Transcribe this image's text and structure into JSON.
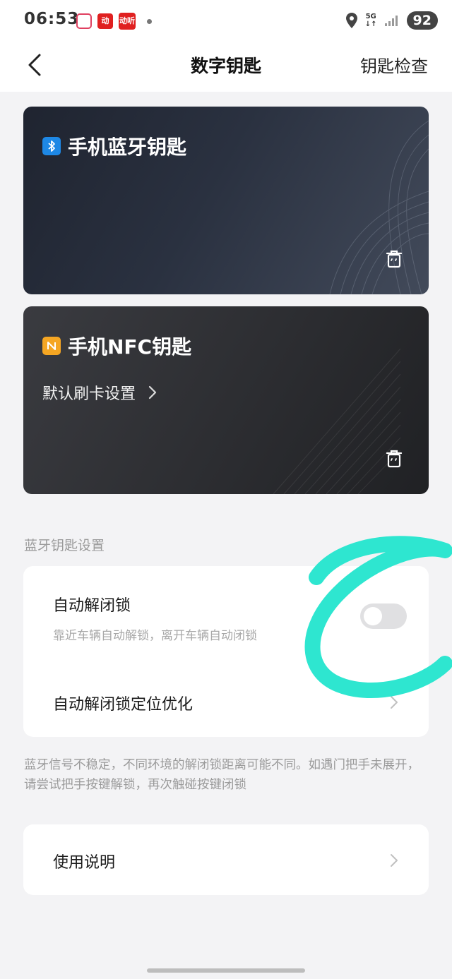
{
  "status_bar": {
    "time": "06:53",
    "app2": "动",
    "app3": "动听",
    "network": "5G",
    "battery": "92"
  },
  "nav": {
    "title": "数字钥匙",
    "right_action": "钥匙检查"
  },
  "cards": [
    {
      "title": "手机蓝牙钥匙",
      "badge_icon": "bluetooth-icon",
      "badge_color": "#1e88e5"
    },
    {
      "title": "手机NFC钥匙",
      "badge_icon": "nfc-icon",
      "badge_color": "#f5a623",
      "sub_link": "默认刷卡设置"
    }
  ],
  "bt_settings": {
    "section_label": "蓝牙钥匙设置",
    "auto_lock": {
      "label": "自动解闭锁",
      "desc": "靠近车辆自动解锁，离开车辆自动闭锁",
      "enabled": false
    },
    "position_opt": {
      "label": "自动解闭锁定位优化"
    },
    "note": "蓝牙信号不稳定，不同环境的解闭锁距离可能不同。如遇门把手未展开，请尝试把手按键解锁，再次触碰按键闭锁"
  },
  "usage": {
    "label": "使用说明"
  },
  "colors": {
    "annotation": "#2ee6d0",
    "toggle_off": "#e0e0e2"
  }
}
